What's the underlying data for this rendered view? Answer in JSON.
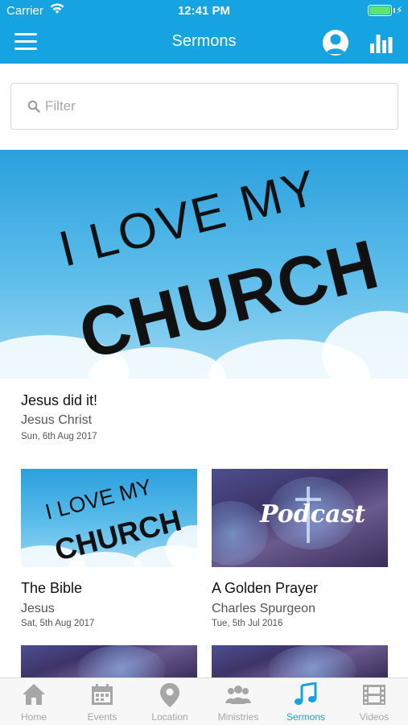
{
  "status_bar": {
    "carrier": "Carrier",
    "time": "12:41 PM"
  },
  "nav": {
    "title": "Sermons"
  },
  "filter": {
    "placeholder": "Filter"
  },
  "featured": {
    "art_line1": "I LOVE MY",
    "art_line2": "CHURCH",
    "title": "Jesus did it!",
    "speaker": "Jesus Christ",
    "date": "Sun, 6th Aug 2017"
  },
  "grid": [
    {
      "art": "church",
      "art_line1": "I LOVE MY",
      "art_line2": "CHURCH",
      "title": "The Bible",
      "speaker": "Jesus",
      "date": "Sat, 5th Aug 2017"
    },
    {
      "art": "podcast",
      "art_text": "Podcast",
      "title": "A Golden Prayer",
      "speaker": "Charles Spurgeon",
      "date": "Tue, 5th Jul 2016"
    }
  ],
  "tabs": [
    {
      "label": "Home",
      "icon": "home-icon"
    },
    {
      "label": "Events",
      "icon": "calendar-icon"
    },
    {
      "label": "Location",
      "icon": "location-pin-icon"
    },
    {
      "label": "Ministries",
      "icon": "people-icon"
    },
    {
      "label": "Sermons",
      "icon": "music-note-icon",
      "active": true
    },
    {
      "label": "Videos",
      "icon": "film-icon"
    }
  ],
  "colors": {
    "accent": "#16a3e2",
    "battery": "#62e36a",
    "tab_inactive": "#a6a6a6"
  }
}
